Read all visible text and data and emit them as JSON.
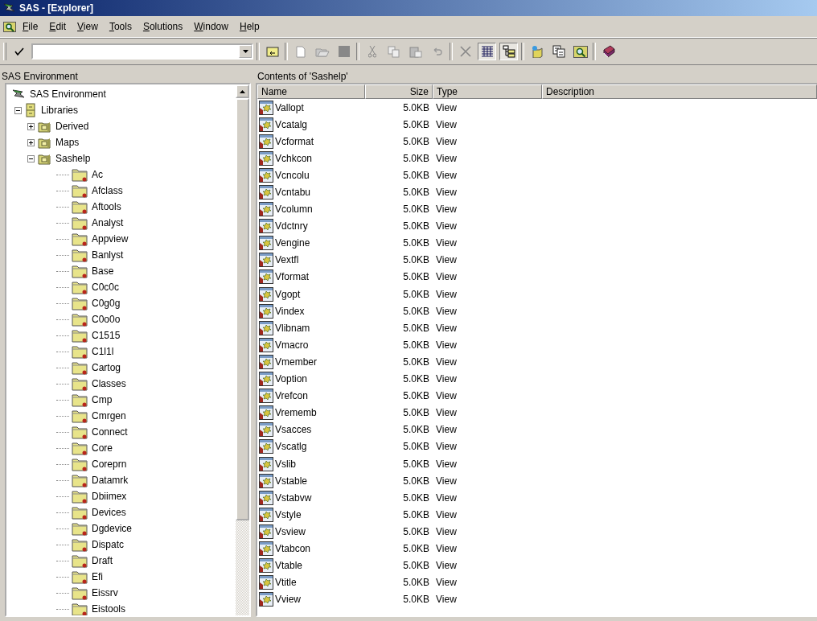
{
  "window": {
    "title": "SAS - [Explorer]"
  },
  "menu": [
    "File",
    "Edit",
    "View",
    "Tools",
    "Solutions",
    "Window",
    "Help"
  ],
  "toolbar": {
    "details_view_pressed": true,
    "tree_view_pressed": true
  },
  "explorer_tree": {
    "header": "SAS Environment",
    "nodes": [
      {
        "label": "SAS Environment",
        "kind": "environment",
        "children": [
          {
            "label": "Libraries",
            "kind": "libraries",
            "expanded": true,
            "children": [
              {
                "label": "Derived",
                "kind": "library",
                "expanded": false
              },
              {
                "label": "Maps",
                "kind": "library",
                "expanded": false
              },
              {
                "label": "Sashelp",
                "kind": "library",
                "expanded": true,
                "children": [
                  {
                    "label": "Ac",
                    "kind": "catalog"
                  },
                  {
                    "label": "Afclass",
                    "kind": "catalog"
                  },
                  {
                    "label": "Aftools",
                    "kind": "catalog"
                  },
                  {
                    "label": "Analyst",
                    "kind": "catalog"
                  },
                  {
                    "label": "Appview",
                    "kind": "catalog"
                  },
                  {
                    "label": "Banlyst",
                    "kind": "catalog"
                  },
                  {
                    "label": "Base",
                    "kind": "catalog"
                  },
                  {
                    "label": "C0c0c",
                    "kind": "catalog"
                  },
                  {
                    "label": "C0g0g",
                    "kind": "catalog"
                  },
                  {
                    "label": "C0o0o",
                    "kind": "catalog"
                  },
                  {
                    "label": "C1515",
                    "kind": "catalog"
                  },
                  {
                    "label": "C1l1l",
                    "kind": "catalog"
                  },
                  {
                    "label": "Cartog",
                    "kind": "catalog"
                  },
                  {
                    "label": "Classes",
                    "kind": "catalog"
                  },
                  {
                    "label": "Cmp",
                    "kind": "catalog"
                  },
                  {
                    "label": "Cmrgen",
                    "kind": "catalog"
                  },
                  {
                    "label": "Connect",
                    "kind": "catalog"
                  },
                  {
                    "label": "Core",
                    "kind": "catalog"
                  },
                  {
                    "label": "Coreprn",
                    "kind": "catalog"
                  },
                  {
                    "label": "Datamrk",
                    "kind": "catalog"
                  },
                  {
                    "label": "Dbiimex",
                    "kind": "catalog"
                  },
                  {
                    "label": "Devices",
                    "kind": "catalog"
                  },
                  {
                    "label": "Dgdevice",
                    "kind": "catalog"
                  },
                  {
                    "label": "Dispatc",
                    "kind": "catalog"
                  },
                  {
                    "label": "Draft",
                    "kind": "catalog"
                  },
                  {
                    "label": "Efi",
                    "kind": "catalog"
                  },
                  {
                    "label": "Eissrv",
                    "kind": "catalog"
                  },
                  {
                    "label": "Eistools",
                    "kind": "catalog"
                  }
                ]
              }
            ]
          }
        ]
      }
    ]
  },
  "contents": {
    "header": "Contents of 'Sashelp'",
    "columns": [
      "Name",
      "Size",
      "Type",
      "Description"
    ],
    "rows": [
      {
        "name": "Vallopt",
        "size": "5.0KB",
        "type": "View"
      },
      {
        "name": "Vcatalg",
        "size": "5.0KB",
        "type": "View"
      },
      {
        "name": "Vcformat",
        "size": "5.0KB",
        "type": "View"
      },
      {
        "name": "Vchkcon",
        "size": "5.0KB",
        "type": "View"
      },
      {
        "name": "Vcncolu",
        "size": "5.0KB",
        "type": "View"
      },
      {
        "name": "Vcntabu",
        "size": "5.0KB",
        "type": "View"
      },
      {
        "name": "Vcolumn",
        "size": "5.0KB",
        "type": "View"
      },
      {
        "name": "Vdctnry",
        "size": "5.0KB",
        "type": "View"
      },
      {
        "name": "Vengine",
        "size": "5.0KB",
        "type": "View"
      },
      {
        "name": "Vextfl",
        "size": "5.0KB",
        "type": "View"
      },
      {
        "name": "Vformat",
        "size": "5.0KB",
        "type": "View"
      },
      {
        "name": "Vgopt",
        "size": "5.0KB",
        "type": "View"
      },
      {
        "name": "Vindex",
        "size": "5.0KB",
        "type": "View"
      },
      {
        "name": "Vlibnam",
        "size": "5.0KB",
        "type": "View"
      },
      {
        "name": "Vmacro",
        "size": "5.0KB",
        "type": "View"
      },
      {
        "name": "Vmember",
        "size": "5.0KB",
        "type": "View"
      },
      {
        "name": "Voption",
        "size": "5.0KB",
        "type": "View"
      },
      {
        "name": "Vrefcon",
        "size": "5.0KB",
        "type": "View"
      },
      {
        "name": "Vrememb",
        "size": "5.0KB",
        "type": "View"
      },
      {
        "name": "Vsacces",
        "size": "5.0KB",
        "type": "View"
      },
      {
        "name": "Vscatlg",
        "size": "5.0KB",
        "type": "View"
      },
      {
        "name": "Vslib",
        "size": "5.0KB",
        "type": "View"
      },
      {
        "name": "Vstable",
        "size": "5.0KB",
        "type": "View"
      },
      {
        "name": "Vstabvw",
        "size": "5.0KB",
        "type": "View"
      },
      {
        "name": "Vstyle",
        "size": "5.0KB",
        "type": "View"
      },
      {
        "name": "Vsview",
        "size": "5.0KB",
        "type": "View"
      },
      {
        "name": "Vtabcon",
        "size": "5.0KB",
        "type": "View"
      },
      {
        "name": "Vtable",
        "size": "5.0KB",
        "type": "View"
      },
      {
        "name": "Vtitle",
        "size": "5.0KB",
        "type": "View"
      },
      {
        "name": "Vview",
        "size": "5.0KB",
        "type": "View"
      }
    ]
  }
}
